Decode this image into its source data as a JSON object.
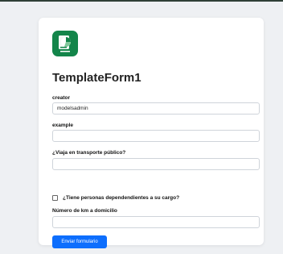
{
  "colors": {
    "accent": "#0d6efd",
    "logo_bg": "#13854a",
    "page_bg": "#eef0f3"
  },
  "logo": {
    "icon": "form-pie-chart-logo"
  },
  "form": {
    "title": "TemplateForm1",
    "fields": {
      "creator": {
        "label": "creator",
        "value": "modelsadmin"
      },
      "example": {
        "label": "example",
        "value": ""
      },
      "transporte": {
        "label": "¿Viaja en transporte público?",
        "value": ""
      },
      "dependientes": {
        "label": "¿Tiene personas dependendientes a su cargo?",
        "checked": false
      },
      "km": {
        "label": "Número de km a domicilio",
        "value": ""
      }
    },
    "submit_label": "Enviar formulario"
  }
}
